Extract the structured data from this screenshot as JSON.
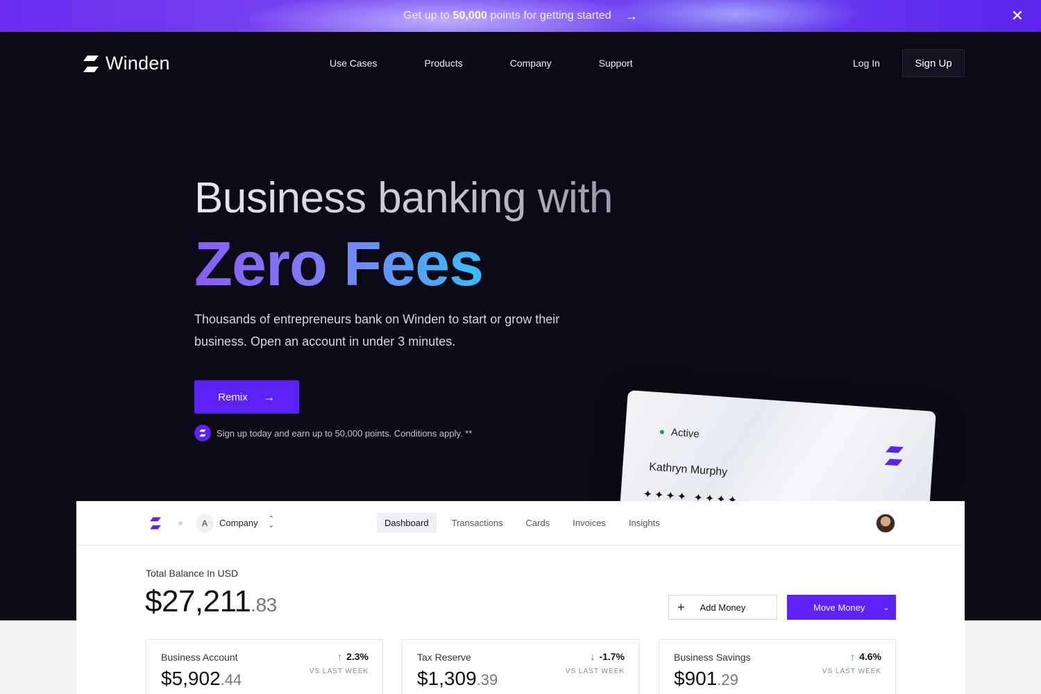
{
  "announcement": {
    "prefix": "Get up to ",
    "highlight": "50,000",
    "suffix": " points for getting started"
  },
  "brand": {
    "name": "Winden"
  },
  "nav": {
    "links": [
      "Use Cases",
      "Products",
      "Company",
      "Support"
    ],
    "login": "Log In",
    "signup": "Sign Up"
  },
  "hero": {
    "headline": "Business banking with",
    "accent": "Zero Fees",
    "subtitle": "Thousands of entrepreneurs bank on Winden to start or grow their business. Open an account in under 3 minutes.",
    "cta": "Remix",
    "note": "Sign up today and earn up to 50,000 points. Conditions apply. **"
  },
  "card": {
    "status": "Active",
    "holder": "Kathryn Murphy",
    "number_mask": "✦✦✦✦ ✦✦✦✦"
  },
  "dashboard": {
    "company_initial": "A",
    "company": "Company",
    "tabs": [
      "Dashboard",
      "Transactions",
      "Cards",
      "Invoices",
      "Insights"
    ],
    "active_tab": "Dashboard",
    "balance_label": "Total Balance In USD",
    "balance_whole": "$27,211",
    "balance_cents": ".83",
    "add_money": "Add Money",
    "move_money": "Move Money",
    "accounts": [
      {
        "name": "Business Account",
        "whole": "$5,902",
        "cents": ".44",
        "change": "2.3%",
        "direction": "up",
        "period": "VS LAST WEEK"
      },
      {
        "name": "Tax Reserve",
        "whole": "$1,309",
        "cents": ".39",
        "change": "-1.7%",
        "direction": "down",
        "period": "VS LAST WEEK"
      },
      {
        "name": "Business Savings",
        "whole": "$901",
        "cents": ".29",
        "change": "4.6%",
        "direction": "up",
        "period": "VS LAST WEEK"
      }
    ]
  },
  "colors": {
    "accent": "#5b21f5",
    "up": "#16a34a",
    "down": "#dc2626"
  }
}
